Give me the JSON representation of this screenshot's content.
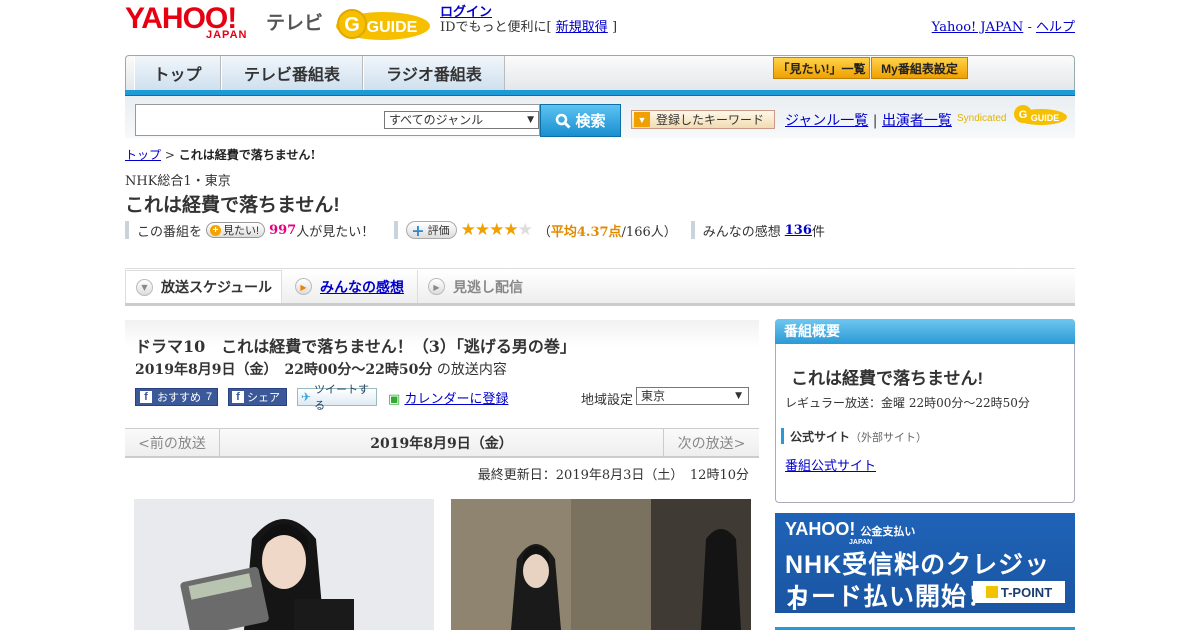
{
  "header": {
    "logo_yahoo": "YAHOO!",
    "logo_japan": "JAPAN",
    "logo_tv": "テレビ",
    "gguide_text": "GUIDE",
    "login_link": "ログイン",
    "login_text_prefix": "IDでもっと便利に[",
    "register_link": "新規取得",
    "login_text_suffix": "]",
    "yahoo_japan_link": "Yahoo! JAPAN",
    "separator": "-",
    "help_link": "ヘルプ"
  },
  "nav": {
    "tabs": [
      "トップ",
      "テレビ番組表",
      "ラジオ番組表"
    ],
    "mitai_list": "「見たい!」一覧",
    "my_schedule": "My番組表設定"
  },
  "search": {
    "genre_selected": "すべてのジャンル",
    "search_button": "検索",
    "keyword_button": "登録したキーワード",
    "genre_list_link": "ジャンル一覧",
    "divider": "|",
    "performer_link": "出演者一覧",
    "syndicated": "Syndicated",
    "synd_guide": "GUIDE"
  },
  "breadcrumb": {
    "top": "トップ",
    "sep": ">",
    "current": "これは経費で落ちません!"
  },
  "program": {
    "channel": "NHK総合1・東京",
    "title": "これは経費で落ちません!",
    "kono_bangumi": "この番組を",
    "mitai_button": "見たい!",
    "mitai_count": "997",
    "mitai_suffix": "人が見たい！",
    "hyouka_button": "評価",
    "stars_on": "★★★★",
    "stars_off": "★",
    "rating_open": "（",
    "rating_avg": "平均4.37点",
    "rating_count": "/166人）",
    "impressions_label": "みんなの感想",
    "impressions_count": "136",
    "impressions_suffix": "件"
  },
  "tabs": {
    "schedule": "放送スケジュール",
    "impressions": "みんなの感想",
    "minogashi": "見逃し配信"
  },
  "episode": {
    "title": "ドラマ10　これは経費で落ちません！（3）「逃げる男の巻」",
    "airtime": "2019年8月9日（金）　22時00分～22時50分",
    "airtime_suffix": "の放送内容",
    "fb_recommend": "おすすめ",
    "fb_count": "7",
    "fb_share": "シェア",
    "tweet": "ツイートする",
    "calendar": "カレンダーに登録",
    "region_label": "地域設定",
    "region_selected": "東京"
  },
  "datebar": {
    "prev": "<前の放送",
    "current": "2019年8月9日（金）",
    "next": "次の放送>"
  },
  "updated": "最終更新日：2019年8月3日（土）　12時10分",
  "sidebar": {
    "heading": "番組概要",
    "title": "これは経費で落ちません!",
    "regular": "レギュラー放送：金曜 22時00分～22時50分",
    "official_label": "公式サイト",
    "official_note": "（外部サイト）",
    "official_link": "番組公式サイト"
  },
  "banner": {
    "line1": "YAHOO!",
    "line1_small": "公金支払い",
    "line1_japan": "JAPAN",
    "line2": "NHK受信料のクレジット",
    "line3": "カード払い開始！",
    "tpoint": "T-POINT"
  },
  "colors": {
    "yahoo_red": "#e60012",
    "nav_blue": "#1e9bd7",
    "accent_orange": "#f0a000",
    "link_blue": "#0000cc",
    "banner_blue": "#1f63b8"
  }
}
